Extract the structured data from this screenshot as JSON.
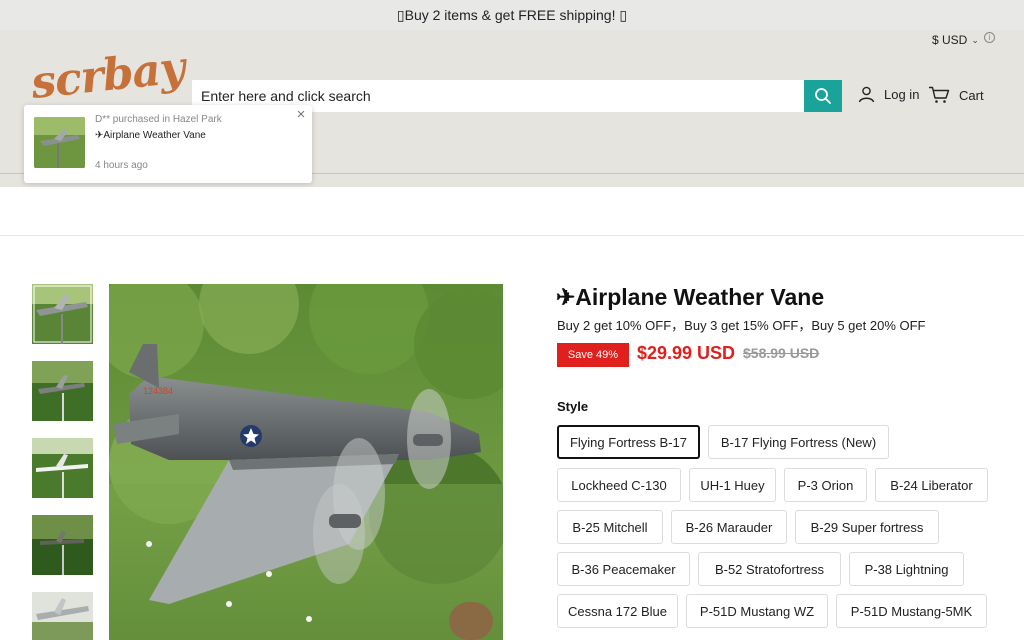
{
  "announcement": {
    "text": "▯Buy 2 items & get FREE shipping! ▯"
  },
  "header": {
    "currency": "$ USD",
    "logo_text": "scrbay",
    "search": {
      "placeholder": "Enter here and click search"
    },
    "login_label": "Log in",
    "cart_label": "Cart"
  },
  "popup": {
    "purchaser_line": "D** purchased in Hazel Park",
    "product_name": "✈Airplane Weather Vane",
    "time_ago": "4 hours ago"
  },
  "product": {
    "title": "✈Airplane Weather Vane",
    "promo": "Buy 2 get 10% OFF，Buy 3 get 15% OFF，Buy 5 get 20% OFF",
    "save_badge": "Save 49%",
    "price": "$29.99 USD",
    "compare_price": "$58.99 USD",
    "style_label": "Style",
    "style_options": [
      "Flying Fortress B-17",
      "B-17 Flying Fortress (New)",
      "Lockheed C-130",
      "UH-1 Huey",
      "P-3 Orion",
      "B-24 Liberator",
      "B-25 Mitchell",
      "B-26 Marauder",
      "B-29 Super fortress",
      "B-36 Peacemaker",
      "B-52 Stratofortress",
      "P-38 Lightning",
      "Cessna 172 Blue",
      "P-51D Mustang WZ",
      "P-51D Mustang-5MK"
    ],
    "selected_style": "Flying Fortress B-17",
    "aircraft_marking": "124384"
  },
  "colors": {
    "accent_teal": "#1aa39a",
    "sale_red": "#e0201c",
    "header_bg": "#e6e4df",
    "logo_orange": "#c6703a"
  }
}
